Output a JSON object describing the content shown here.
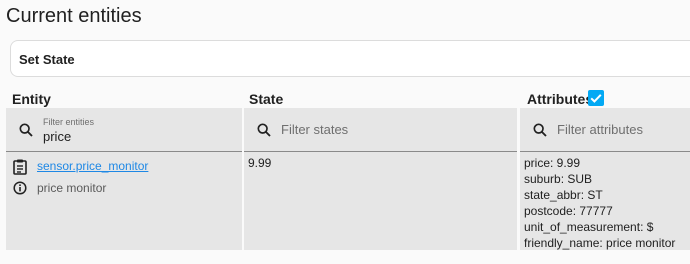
{
  "page_title": "Current entities",
  "set_state_label": "Set State",
  "columns": {
    "entity": "Entity",
    "state": "State",
    "attributes": "Attributes"
  },
  "attributes_checkbox_checked": true,
  "filters": {
    "entity": {
      "label": "Filter entities",
      "value": "price"
    },
    "state": {
      "placeholder": "Filter states"
    },
    "attributes": {
      "placeholder": "Filter attributes"
    }
  },
  "rows": [
    {
      "entity_id": "sensor.price_monitor",
      "friendly_name": "price monitor",
      "state": "9.99",
      "attributes": [
        "price: 9.99",
        "suburb: SUB",
        "state_abbr: ST",
        "postcode: 77777",
        "unit_of_measurement: $",
        "friendly_name: price monitor"
      ]
    }
  ],
  "colors": {
    "accent": "#03a9f4",
    "link": "#1e88e5",
    "filter_bg": "#e6e6e6"
  }
}
